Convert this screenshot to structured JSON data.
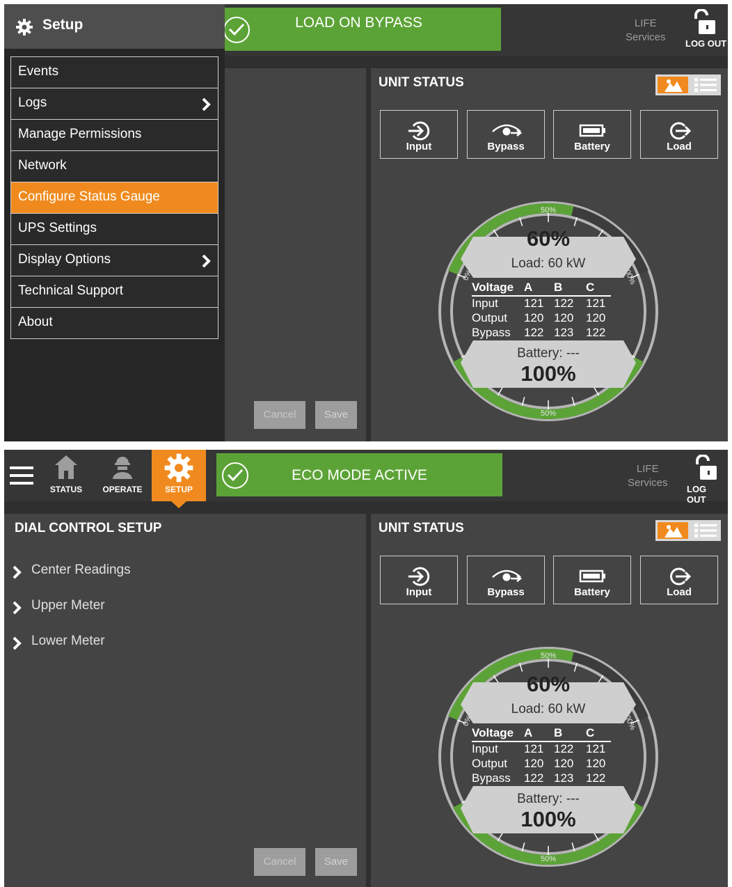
{
  "screen1": {
    "banner": "LOAD ON BYPASS",
    "life": [
      "LIFE",
      "Services"
    ],
    "logout": "LOG OUT",
    "menu": {
      "title": "Setup",
      "items": [
        {
          "label": "Events",
          "submenu": false,
          "active": false
        },
        {
          "label": "Logs",
          "submenu": true,
          "active": false
        },
        {
          "label": "Manage Permissions",
          "submenu": false,
          "active": false
        },
        {
          "label": "Network",
          "submenu": false,
          "active": false
        },
        {
          "label": "Configure Status Gauge",
          "submenu": false,
          "active": true
        },
        {
          "label": "UPS Settings",
          "submenu": false,
          "active": false
        },
        {
          "label": "Display Options",
          "submenu": true,
          "active": false
        },
        {
          "label": "Technical Support",
          "submenu": false,
          "active": false
        },
        {
          "label": "About",
          "submenu": false,
          "active": false
        }
      ]
    },
    "cancel": "Cancel",
    "save": "Save"
  },
  "screen2": {
    "banner": "ECO MODE ACTIVE",
    "life": [
      "LIFE",
      "Services"
    ],
    "logout": "LOG OUT",
    "nav": [
      {
        "label": "STATUS",
        "icon": "home-icon",
        "active": false
      },
      {
        "label": "OPERATE",
        "icon": "operator-icon",
        "active": false
      },
      {
        "label": "SETUP",
        "icon": "gear-icon",
        "active": true
      }
    ],
    "dial_setup": {
      "title": "DIAL CONTROL SETUP",
      "sections": [
        "Center Readings",
        "Upper Meter",
        "Lower Meter"
      ]
    },
    "cancel": "Cancel",
    "save": "Save"
  },
  "unit_status": {
    "title": "UNIT STATUS",
    "buttons": [
      {
        "label": "Input",
        "icon": "input-icon"
      },
      {
        "label": "Bypass",
        "icon": "bypass-icon"
      },
      {
        "label": "Battery",
        "icon": "battery-icon"
      },
      {
        "label": "Load",
        "icon": "load-icon"
      }
    ],
    "gauge": {
      "load_percent": "60%",
      "load_text": "Load: 60 kW",
      "battery_text": "Battery: ---",
      "battery_percent": "100%",
      "upper_meter_fill": 0.6,
      "lower_meter_fill": 1.0,
      "scale_labels": [
        "0%",
        "50%",
        "100%"
      ],
      "voltage": {
        "header": [
          "Voltage",
          "A",
          "B",
          "C"
        ],
        "rows": [
          {
            "name": "Input",
            "a": "121",
            "b": "122",
            "c": "121"
          },
          {
            "name": "Output",
            "a": "120",
            "b": "120",
            "c": "120"
          },
          {
            "name": "Bypass",
            "a": "122",
            "b": "123",
            "c": "122"
          }
        ]
      }
    }
  },
  "colors": {
    "accent": "#f08a1e",
    "banner_green": "#5ca337",
    "meter_green": "#5ca337",
    "panel": "#444444",
    "background": "#2f2f2f"
  }
}
